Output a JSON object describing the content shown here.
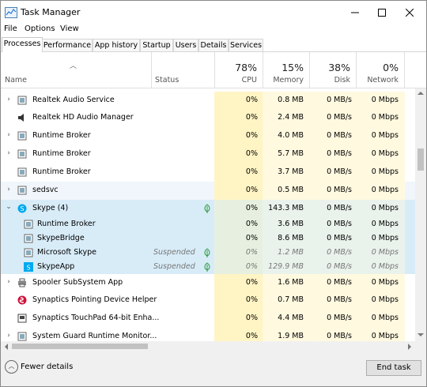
{
  "window": {
    "title": "Task Manager"
  },
  "menu": [
    "File",
    "Options",
    "View"
  ],
  "tabs": [
    "Processes",
    "Performance",
    "App history",
    "Startup",
    "Users",
    "Details",
    "Services"
  ],
  "header": {
    "name": "Name",
    "status": "Status",
    "cpu": {
      "percent": "78%",
      "label": "CPU"
    },
    "memory": {
      "percent": "15%",
      "label": "Memory"
    },
    "disk": {
      "percent": "38%",
      "label": "Disk"
    },
    "network": {
      "percent": "0%",
      "label": "Network"
    }
  },
  "rows": [
    {
      "name": "Realtek Audio Service",
      "cpu": "0%",
      "memory": "0.8 MB",
      "disk": "0 MB/s",
      "network": "0 Mbps"
    },
    {
      "name": "Realtek HD Audio Manager",
      "cpu": "0%",
      "memory": "2.4 MB",
      "disk": "0 MB/s",
      "network": "0 Mbps"
    },
    {
      "name": "Runtime Broker",
      "cpu": "0%",
      "memory": "4.0 MB",
      "disk": "0 MB/s",
      "network": "0 Mbps"
    },
    {
      "name": "Runtime Broker",
      "cpu": "0%",
      "memory": "5.7 MB",
      "disk": "0 MB/s",
      "network": "0 Mbps"
    },
    {
      "name": "Runtime Broker",
      "cpu": "0%",
      "memory": "3.7 MB",
      "disk": "0 MB/s",
      "network": "0 Mbps"
    },
    {
      "name": "sedsvc",
      "cpu": "0%",
      "memory": "0.5 MB",
      "disk": "0 MB/s",
      "network": "0 Mbps"
    },
    {
      "name": "Skype (4)",
      "cpu": "0%",
      "memory": "143.3 MB",
      "disk": "0 MB/s",
      "network": "0 Mbps"
    },
    {
      "name": "Runtime Broker",
      "cpu": "0%",
      "memory": "3.6 MB",
      "disk": "0 MB/s",
      "network": "0 Mbps"
    },
    {
      "name": "SkypeBridge",
      "cpu": "0%",
      "memory": "8.6 MB",
      "disk": "0 MB/s",
      "network": "0 Mbps"
    },
    {
      "name": "Microsoft Skype",
      "status": "Suspended",
      "cpu": "0%",
      "memory": "1.2 MB",
      "disk": "0 MB/s",
      "network": "0 Mbps"
    },
    {
      "name": "SkypeApp",
      "status": "Suspended",
      "cpu": "0%",
      "memory": "129.9 MB",
      "disk": "0 MB/s",
      "network": "0 Mbps"
    },
    {
      "name": "Spooler SubSystem App",
      "cpu": "0%",
      "memory": "1.6 MB",
      "disk": "0 MB/s",
      "network": "0 Mbps"
    },
    {
      "name": "Synaptics Pointing Device Helper",
      "cpu": "0%",
      "memory": "0.7 MB",
      "disk": "0 MB/s",
      "network": "0 Mbps"
    },
    {
      "name": "Synaptics TouchPad 64-bit Enha...",
      "cpu": "0%",
      "memory": "4.4 MB",
      "disk": "0 MB/s",
      "network": "0 Mbps"
    },
    {
      "name": "System Guard Runtime Monitor...",
      "cpu": "0%",
      "memory": "1.9 MB",
      "disk": "0 MB/s",
      "network": "0 Mbps"
    }
  ],
  "footer": {
    "fewer_details": "Fewer details",
    "end_task": "End task"
  },
  "colors": {
    "selected_row": "#d8ecf8",
    "cpu_column": "#fff4c4",
    "column_tint": "#fff9e0",
    "leaf_green": "#2a9a3a"
  }
}
